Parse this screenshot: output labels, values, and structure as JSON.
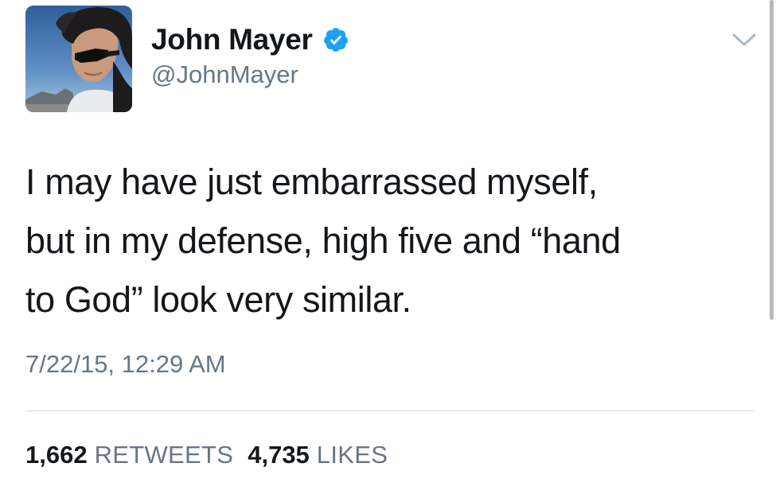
{
  "tweet": {
    "author": {
      "display_name": "John Mayer",
      "handle": "@JohnMayer",
      "verified": true
    },
    "text_lines": [
      "I may have just embarrassed myself,",
      "but in my defense, high five and “hand",
      "to God” look very similar."
    ],
    "timestamp": "7/22/15, 12:29 AM",
    "stats": {
      "retweets_count": "1,662",
      "retweets_label": "RETWEETS",
      "likes_count": "4,735",
      "likes_label": "LIKES"
    },
    "icons": {
      "verified": "verified-badge-icon",
      "menu": "chevron-down-icon"
    },
    "colors": {
      "verified_blue": "#1da1f2",
      "secondary_text": "#657786",
      "primary_text": "#14171a",
      "divider": "#d6dbdf"
    }
  }
}
